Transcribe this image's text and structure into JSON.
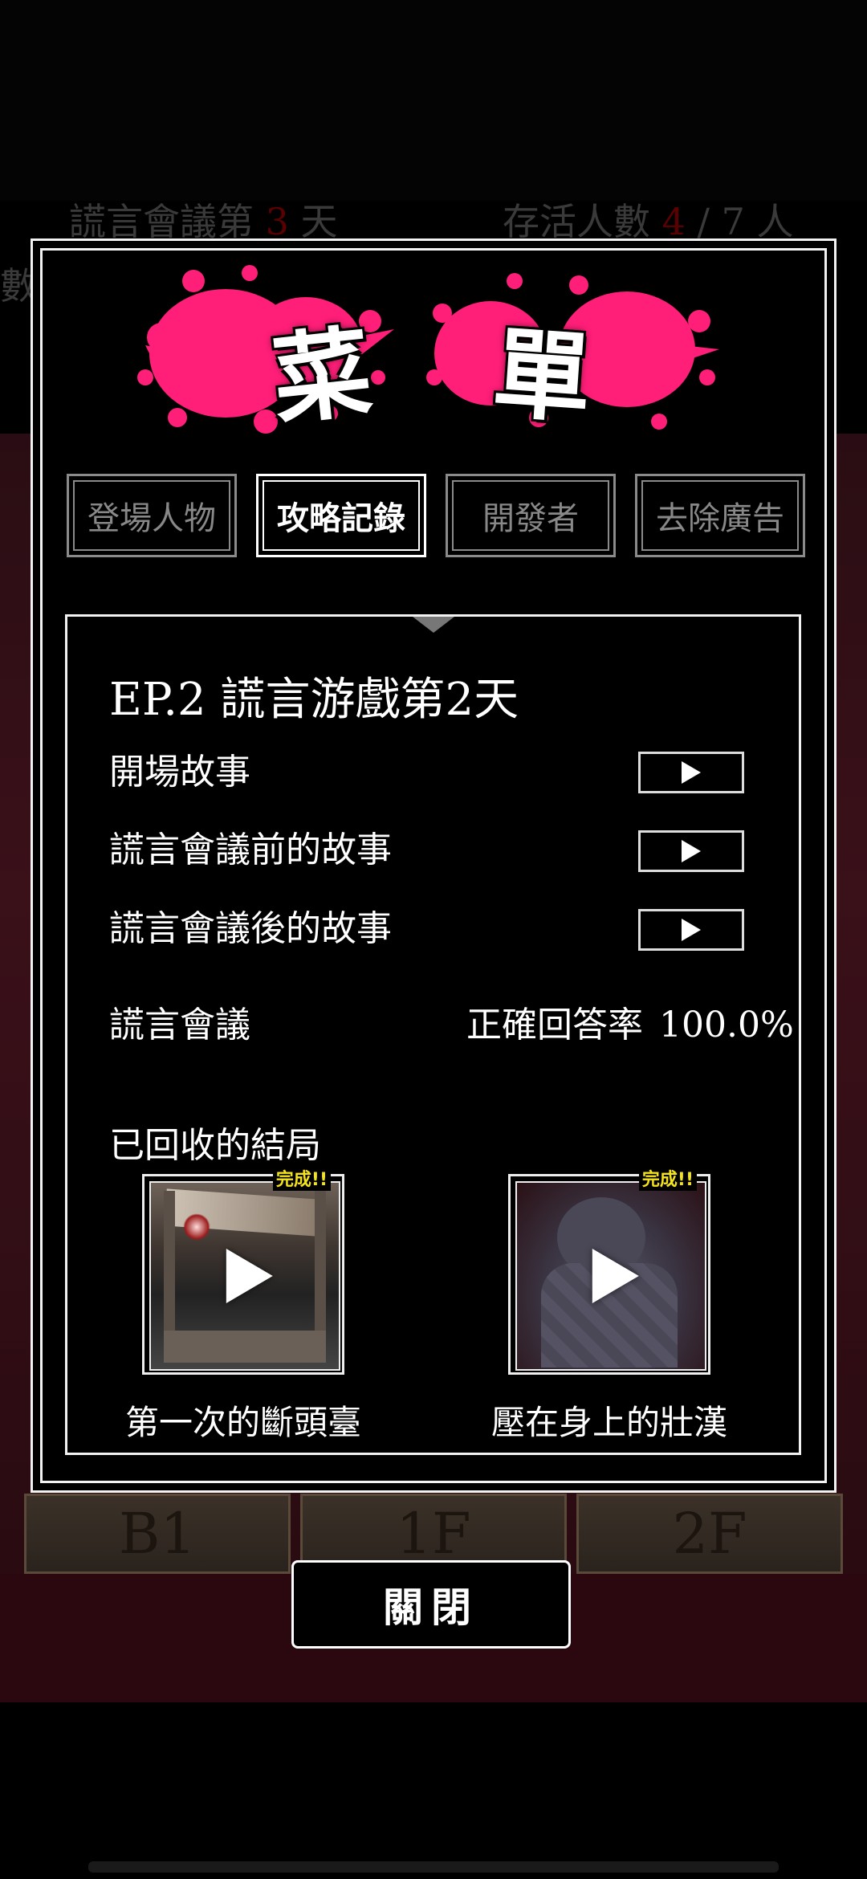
{
  "background": {
    "status_left_prefix": "謊言會議第",
    "status_day": "3",
    "status_left_suffix": "天",
    "status_right_prefix": "存活人數",
    "status_alive": "4",
    "status_right_suffix": "/ 7 人",
    "left_stub": "數",
    "doors": [
      "B1",
      "1F",
      "2F"
    ]
  },
  "modal": {
    "title_chars": [
      "菜",
      "單"
    ],
    "splat_color": "#ff1e78",
    "tabs": [
      {
        "label": "登場人物",
        "active": false
      },
      {
        "label": "攻略記錄",
        "active": true
      },
      {
        "label": "開發者",
        "active": false
      },
      {
        "label": "去除廣告",
        "active": false
      }
    ],
    "episode": {
      "title": "EP.2  謊言游戲第2天",
      "stories": [
        {
          "label": "開場故事"
        },
        {
          "label": "謊言會議前的故事"
        },
        {
          "label": "謊言會議後的故事"
        }
      ],
      "meeting_label": "謊言會議",
      "rate_label": "正確回答率",
      "rate_value": "100.0%",
      "endings_label": "已回收的結局",
      "endings": [
        {
          "caption": "第一次的斷頭臺",
          "badge": "完成!!"
        },
        {
          "caption": "壓在身上的壯漢",
          "badge": "完成!!"
        }
      ]
    }
  },
  "close_label": "關閉"
}
